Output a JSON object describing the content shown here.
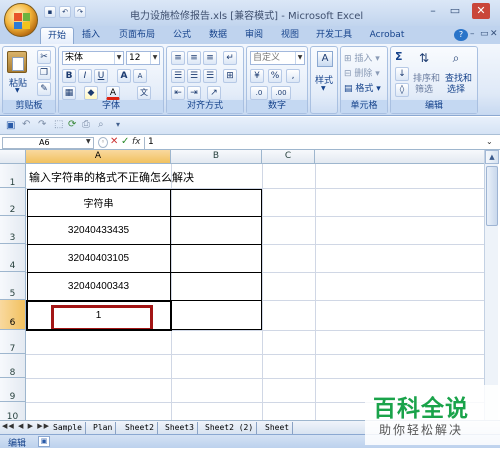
{
  "window": {
    "title": "电力设施检修报告.xls [兼容模式] - Microsoft Excel",
    "controls": [
      "–",
      "▭",
      "✕"
    ]
  },
  "tabs": [
    "开始",
    "插入",
    "页面布局",
    "公式",
    "数据",
    "审阅",
    "视图",
    "开发工具",
    "Acrobat"
  ],
  "ribbon": {
    "clipboard": {
      "label": "剪贴板",
      "paste": "粘贴"
    },
    "font": {
      "label": "字体",
      "font_name": "宋体",
      "font_size": "12",
      "bold": "B",
      "italic": "I",
      "underline": "U",
      "grow": "A",
      "shrink": "A",
      "color_a": "A",
      "phonetic": "文"
    },
    "alignment": {
      "label": "对齐方式"
    },
    "number": {
      "label": "数字",
      "format": "自定义",
      "percent": "%",
      "comma": ",",
      "dec_inc": ".0",
      "dec_dec": ".00"
    },
    "styles": {
      "label": "样式"
    },
    "cells": {
      "label": "单元格",
      "insert": "插入",
      "delete": "删除",
      "format": "格式"
    },
    "editing": {
      "label": "编辑",
      "sum": "Σ",
      "sort": "排序和",
      "sort2": "筛选",
      "find": "查找和",
      "find2": "选择"
    }
  },
  "formula_bar": {
    "name_box": "A6",
    "fx": "fx",
    "value": "1"
  },
  "columns": [
    "A",
    "B",
    "C"
  ],
  "rows": [
    "1",
    "2",
    "3",
    "4",
    "5",
    "6",
    "7",
    "8",
    "9",
    "10"
  ],
  "cells": {
    "A1": "输入字符串的格式不正确怎么解决",
    "A2": "字符串",
    "A3": "32040433435",
    "A4": "32040403105",
    "A5": "32040400343",
    "A6": "1"
  },
  "sheet_tabs": [
    "Sample",
    "Plan",
    "Sheet2",
    "Sheet3",
    "Sheet2 (2)",
    "Sheet"
  ],
  "status": {
    "mode": "编辑"
  },
  "watermark": {
    "line1": "百科全说",
    "line2": "助你轻松解决"
  },
  "colors": {
    "accent": "#15428b",
    "selection_border": "#a31515",
    "watermark_green": "#1aa34a"
  }
}
